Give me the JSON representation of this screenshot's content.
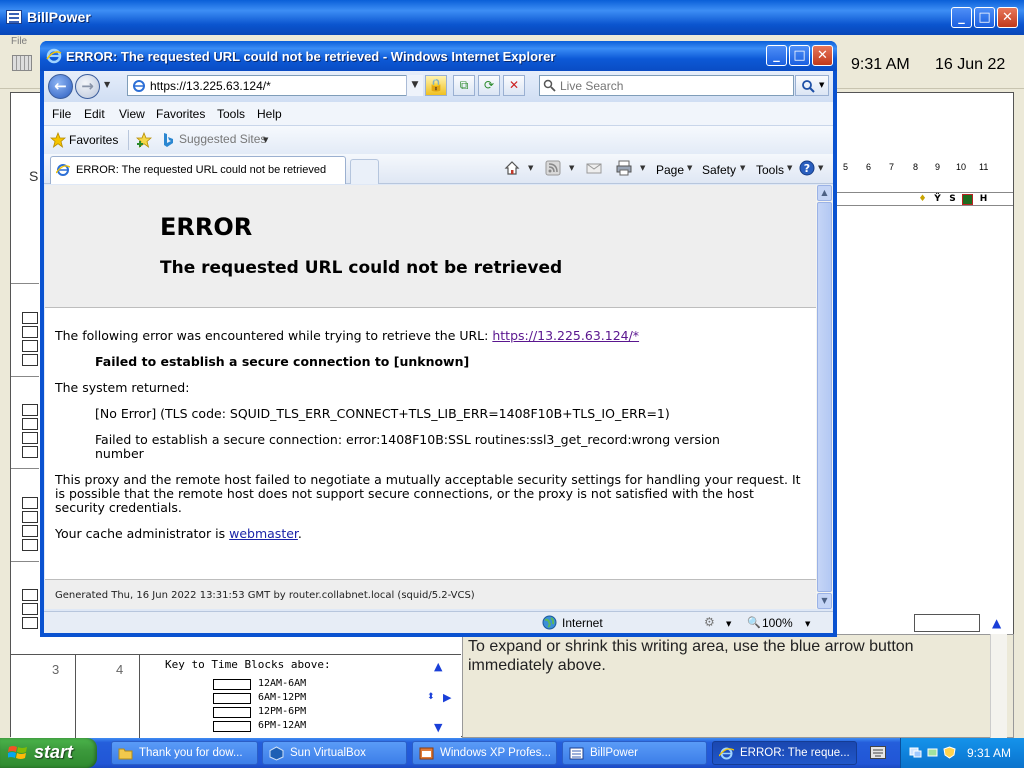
{
  "billpower": {
    "title": "BillPower",
    "menu_file": "File",
    "time": "9:31 AM",
    "date": "16 Jun 22",
    "side_label": "S",
    "hours": [
      "5",
      "6",
      "7",
      "8",
      "9",
      "10",
      "11"
    ],
    "hour_row_icons": [
      "bulb-icon",
      "antenna-icon",
      "S",
      "book-icon",
      "H"
    ],
    "row_numbers": [
      "3",
      "4"
    ],
    "key_title": "Key to Time Blocks above:",
    "key_rows": [
      "12AM-6AM",
      "6AM-12PM",
      "12PM-6PM",
      "6PM-12AM"
    ],
    "notes_text": "To expand or shrink this writing area, use the blue arrow button immediately above."
  },
  "ie": {
    "window_title": "ERROR: The requested URL could not be retrieved - Windows Internet Explorer",
    "address": "https://13.225.63.124/*",
    "search_placeholder": "Live Search",
    "menu": [
      "File",
      "Edit",
      "View",
      "Favorites",
      "Tools",
      "Help"
    ],
    "favorites_label": "Favorites",
    "suggested_sites": "Suggested Sites",
    "tab_title": "ERROR: The requested URL could not be retrieved",
    "commands": {
      "page": "Page",
      "safety": "Safety",
      "tools": "Tools"
    },
    "status_zone": "Internet",
    "zoom": "100%"
  },
  "page": {
    "h1": "ERROR",
    "h2": "The requested URL could not be retrieved",
    "intro": "The following error was encountered while trying to retrieve the URL: ",
    "url": "https://13.225.63.124/*",
    "failed": "Failed to establish a secure connection to [unknown]",
    "system_returned": "The system returned:",
    "no_error": "[No Error] (TLS code: SQUID_TLS_ERR_CONNECT+TLS_LIB_ERR=1408F10B+TLS_IO_ERR=1)",
    "ssl_error": "Failed to establish a secure connection: error:1408F10B:SSL routines:ssl3_get_record:wrong version number",
    "explanation": "This proxy and the remote host failed to negotiate a mutually acceptable security settings for handling your request. It is possible that the remote host does not support secure connections, or the proxy is not satisfied with the host security credentials.",
    "admin_prefix": "Your cache administrator is ",
    "admin_link": "webmaster",
    "admin_suffix": ".",
    "footer": "Generated Thu, 16 Jun 2022 13:31:53 GMT by router.collabnet.local (squid/5.2-VCS)"
  },
  "taskbar": {
    "start": "start",
    "items": [
      {
        "label": "Thank you for dow...",
        "icon": "folder-icon"
      },
      {
        "label": "Sun VirtualBox",
        "icon": "virtualbox-icon"
      },
      {
        "label": "Windows XP Profes...",
        "icon": "vm-window-icon"
      },
      {
        "label": "BillPower",
        "icon": "app-icon"
      },
      {
        "label": "ERROR: The reque...",
        "icon": "ie-icon"
      }
    ],
    "clock": "9:31 AM"
  },
  "colors": {
    "xp_blue": "#0a52d0",
    "link_visited": "#5a168f",
    "link": "#1a23a8",
    "start_green": "#3c9a3c"
  }
}
